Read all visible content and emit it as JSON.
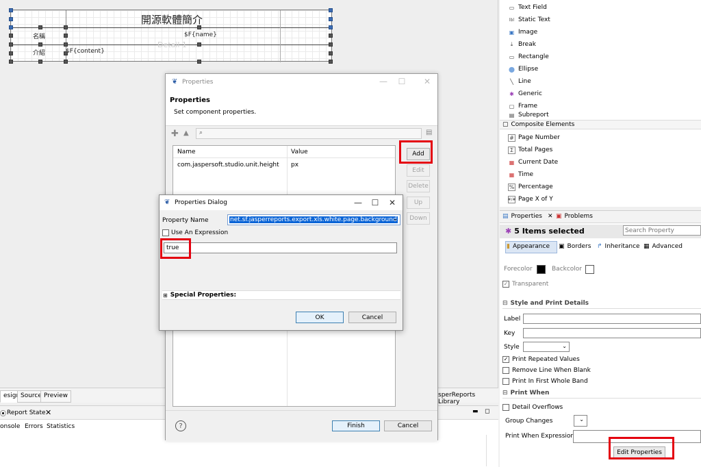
{
  "report": {
    "title": "開源軟體簡介",
    "row1_label": "名稱",
    "row1_field": "$F{name}",
    "row2_label": "介紹",
    "row2_field": "$F{content}",
    "band_label": "Detail 1"
  },
  "editor_tabs": [
    "esign",
    "Source",
    "Preview"
  ],
  "library_tab": "sperReports Library",
  "bottom_panel": {
    "tab": "Report State",
    "subtabs": [
      "onsole",
      "Errors",
      "Statistics"
    ]
  },
  "palette": {
    "items": [
      {
        "label": "Text Field",
        "icon": "text-field-icon"
      },
      {
        "label": "Static Text",
        "icon": "static-text-icon"
      },
      {
        "label": "Image",
        "icon": "image-icon"
      },
      {
        "label": "Break",
        "icon": "break-icon"
      },
      {
        "label": "Rectangle",
        "icon": "rectangle-icon"
      },
      {
        "label": "Ellipse",
        "icon": "ellipse-icon"
      },
      {
        "label": "Line",
        "icon": "line-icon"
      },
      {
        "label": "Generic",
        "icon": "generic-icon"
      },
      {
        "label": "Frame",
        "icon": "frame-icon"
      },
      {
        "label": "Subreport",
        "icon": "subreport-icon"
      }
    ],
    "composite_header": "Composite Elements",
    "composite_items": [
      {
        "label": "Page Number",
        "icon": "page-number-icon"
      },
      {
        "label": "Total Pages",
        "icon": "total-pages-icon"
      },
      {
        "label": "Current Date",
        "icon": "calendar-icon"
      },
      {
        "label": "Time",
        "icon": "time-icon"
      },
      {
        "label": "Percentage",
        "icon": "percentage-icon"
      },
      {
        "label": "Page X of Y",
        "icon": "page-x-of-y-icon"
      }
    ]
  },
  "properties_panel": {
    "tabs": [
      "Properties",
      "Problems"
    ],
    "selection": "5 Items selected",
    "search_placeholder": "Search Property",
    "subtabs": [
      "Appearance",
      "Borders",
      "Inheritance",
      "Advanced"
    ],
    "forecolor_label": "Forecolor",
    "backcolor_label": "Backcolor",
    "transparent_label": "Transparent",
    "section_style": "Style and Print Details",
    "label_label": "Label",
    "key_label": "Key",
    "style_label": "Style",
    "print_repeated": "Print Repeated Values",
    "remove_blank": "Remove Line When Blank",
    "print_first_band": "Print In First Whole Band",
    "section_print_when": "Print When",
    "detail_overflows": "Detail Overflows",
    "group_changes": "Group Changes",
    "print_when_expr": "Print When Expression",
    "edit_properties": "Edit Properties"
  },
  "wizard": {
    "window_title": "Properties",
    "heading": "Properties",
    "description": "Set component properties.",
    "col_name": "Name",
    "col_value": "Value",
    "rows": [
      {
        "name": "com.jaspersoft.studio.unit.height",
        "value": "px"
      }
    ],
    "buttons": {
      "add": "Add",
      "edit": "Edit",
      "delete": "Delete",
      "up": "Up",
      "down": "Down"
    },
    "finish": "Finish",
    "cancel": "Cancel",
    "help": "?"
  },
  "dialog": {
    "title": "Properties Dialog",
    "property_name_label": "Property Name",
    "property_name_value": "net.sf.jasperreports.export.xls.white.page.background",
    "use_expression_label": "Use An Expression",
    "value": "true",
    "special_properties": "Special Properties:",
    "ok": "OK",
    "cancel": "Cancel"
  },
  "colors": {
    "highlight_red": "#e4000f",
    "selection_blue": "#3c6db4",
    "forecolor": "#000000",
    "backcolor": "#ffffff"
  }
}
